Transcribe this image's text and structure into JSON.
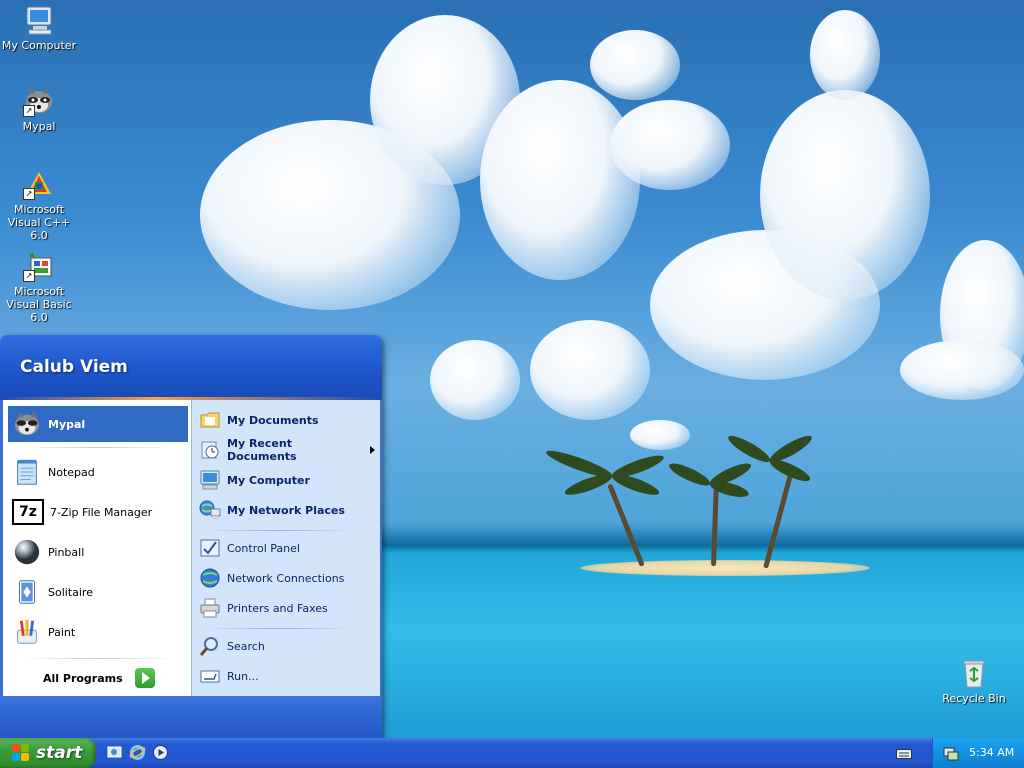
{
  "desktop": {
    "icons": [
      {
        "label": "My Computer",
        "icon": "my-computer-icon"
      },
      {
        "label": "Mypal",
        "icon": "mypal-icon"
      },
      {
        "label": "Microsoft Visual C++ 6.0",
        "icon": "visual-cpp-icon"
      },
      {
        "label": "Microsoft Visual Basic 6.0",
        "icon": "visual-basic-icon"
      },
      {
        "label": "Recycle Bin",
        "icon": "recycle-bin-icon"
      }
    ]
  },
  "start_menu": {
    "user_name": "Calub Viem",
    "left_items": [
      {
        "label": "Mypal",
        "icon": "mypal-icon",
        "highlighted": true
      },
      {
        "label": "Notepad",
        "icon": "notepad-icon"
      },
      {
        "label": "7-Zip File Manager",
        "icon": "7zip-icon",
        "icon_text": "7z"
      },
      {
        "label": "Pinball",
        "icon": "pinball-icon"
      },
      {
        "label": "Solitaire",
        "icon": "solitaire-icon"
      },
      {
        "label": "Paint",
        "icon": "paint-icon"
      }
    ],
    "all_programs": "All Programs",
    "right_items": [
      {
        "label": "My Documents",
        "icon": "my-documents-icon",
        "bold": true
      },
      {
        "label": "My Recent Documents",
        "icon": "recent-documents-icon",
        "bold": true,
        "submenu": true
      },
      {
        "label": "My Computer",
        "icon": "my-computer-icon",
        "bold": true
      },
      {
        "label": "My Network Places",
        "icon": "network-places-icon",
        "bold": true
      },
      {
        "label": "Control Panel",
        "icon": "control-panel-icon"
      },
      {
        "label": "Network Connections",
        "icon": "network-connections-icon"
      },
      {
        "label": "Printers and Faxes",
        "icon": "printers-icon"
      },
      {
        "label": "Search",
        "icon": "search-icon"
      },
      {
        "label": "Run...",
        "icon": "run-icon"
      }
    ]
  },
  "taskbar": {
    "start_label": "start",
    "quick_launch": [
      "show-desktop-icon",
      "internet-explorer-icon",
      "media-player-icon"
    ],
    "clock": "5:34 AM"
  },
  "colors": {
    "taskbar_blue": "#2458d3",
    "start_green": "#3c9b3a",
    "menu_header": "#1e55c8",
    "menu_right_panel": "#d3e5fa",
    "highlight": "#316ac5",
    "tray": "#1290e0"
  }
}
